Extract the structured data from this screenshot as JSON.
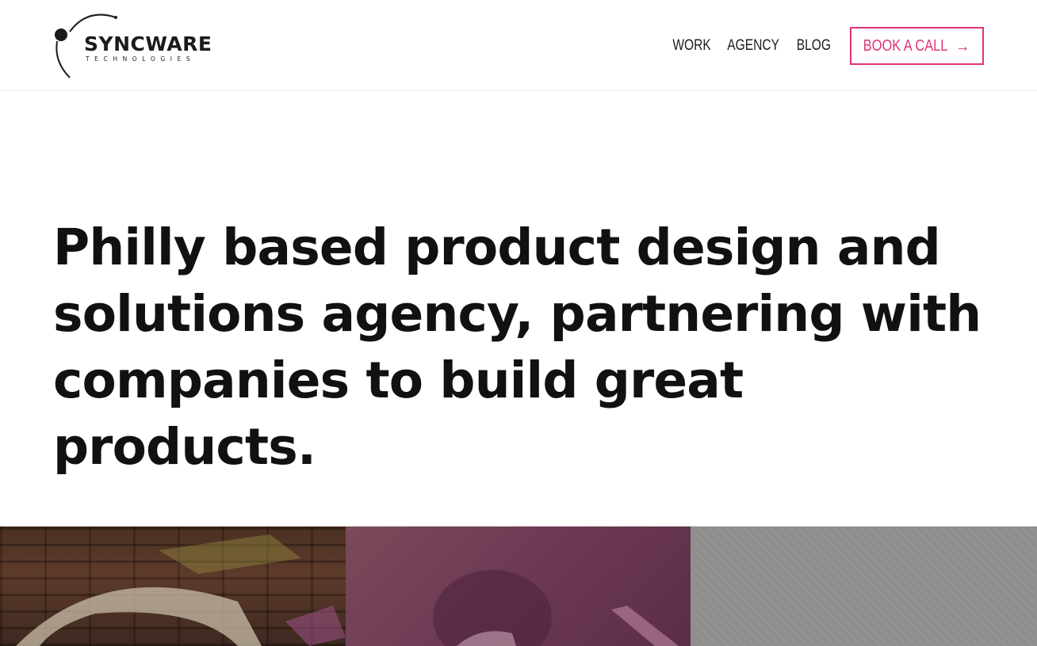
{
  "header": {
    "logo": {
      "name": "SYNCWARE",
      "sub": "TECHNOLOGIES"
    },
    "nav": [
      {
        "label": "WORK"
      },
      {
        "label": "AGENCY"
      },
      {
        "label": "BLOG"
      }
    ],
    "cta": {
      "label": "BOOK A CALL",
      "arrow": "→"
    }
  },
  "hero": {
    "headline": "Philly based product design and solutions agency, partnering with companies to build great products."
  },
  "gallery": {
    "tiles": [
      {
        "name": "brick-wall-art"
      },
      {
        "name": "purple-portrait"
      },
      {
        "name": "gray-pattern"
      }
    ]
  },
  "colors": {
    "accent": "#e0337a",
    "text": "#111111",
    "background": "#ffffff"
  }
}
